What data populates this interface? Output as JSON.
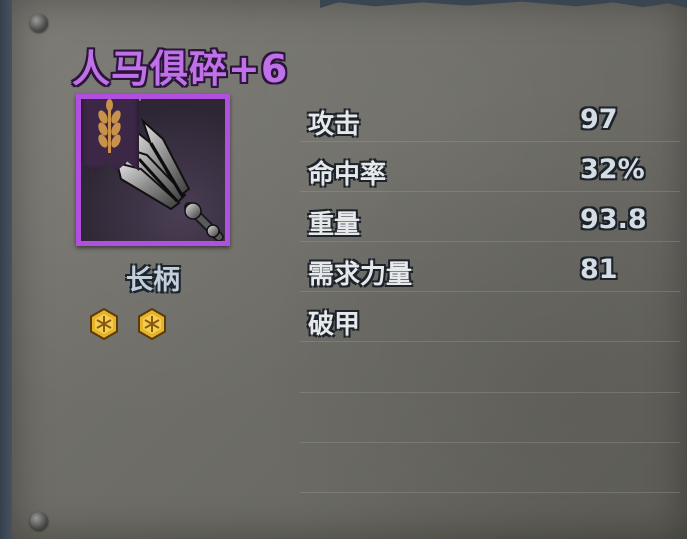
{
  "item": {
    "name": "人马俱碎+6",
    "category": "长柄",
    "rarity_color": "#b04fe0",
    "badges": [
      "gold-hexagon-icon",
      "gold-hexagon-icon"
    ]
  },
  "stats": [
    {
      "label": "攻击",
      "value": "97"
    },
    {
      "label": "命中率",
      "value": "32%"
    },
    {
      "label": "重量",
      "value": "93.8"
    },
    {
      "label": "需求力量",
      "value": "81"
    },
    {
      "label": "破甲",
      "value": ""
    }
  ]
}
